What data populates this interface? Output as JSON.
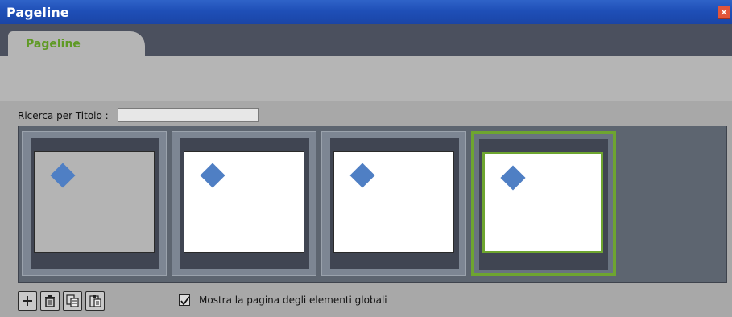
{
  "window": {
    "title": "Pageline",
    "close_icon": "close-icon"
  },
  "tabs": [
    {
      "label": "Pageline",
      "active": true
    }
  ],
  "search": {
    "label": "Ricerca per Titolo :",
    "value": "",
    "placeholder": ""
  },
  "pages": [
    {
      "canvas": "grey",
      "selected": false,
      "icon": "diamond-shape"
    },
    {
      "canvas": "white",
      "selected": false,
      "icon": "diamond-shape"
    },
    {
      "canvas": "white",
      "selected": false,
      "icon": "diamond-shape"
    },
    {
      "canvas": "white",
      "selected": true,
      "icon": "diamond-shape"
    }
  ],
  "toolbar": {
    "buttons": [
      {
        "name": "add-page",
        "icon": "plus-icon"
      },
      {
        "name": "delete-page",
        "icon": "trash-icon"
      },
      {
        "name": "duplicate-page",
        "icon": "duplicate-icon"
      },
      {
        "name": "paste-page",
        "icon": "paste-icon"
      }
    ],
    "show_global_checkbox": {
      "label": "Mostra la pagina degli elementi globali",
      "checked": true
    }
  },
  "colors": {
    "accent": "#6ea530",
    "titlebar": "#2a5bc2",
    "diamond": "#4f7fc4",
    "panel_bg": "#5d6570"
  }
}
